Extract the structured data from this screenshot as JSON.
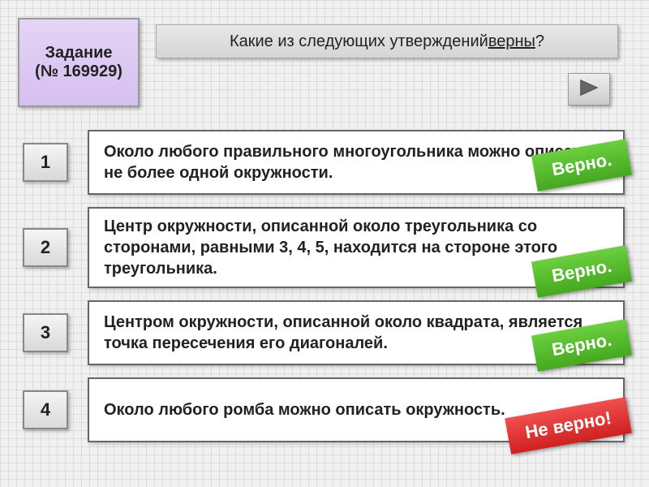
{
  "task": {
    "label": "Задание",
    "number": "(№ 169929)"
  },
  "question": {
    "prefix": "Какие из следующих утверждений ",
    "underlined": "верны",
    "suffix": "?"
  },
  "answers": [
    {
      "num": "1",
      "text": "Около любого правильного многоугольника можно описать не более одной окружности.",
      "badge": "Верно.",
      "correct": true
    },
    {
      "num": "2",
      "text": "Центр окружности, описанной около треугольника со сторонами, равными 3, 4, 5, находится на стороне этого треугольника.",
      "badge": "Верно.",
      "correct": true
    },
    {
      "num": "3",
      "text": "Центром окружности, описанной около квадрата, является точка пересечения его диагоналей.",
      "badge": "Верно.",
      "correct": true
    },
    {
      "num": "4",
      "text": "Около любого ромба можно описать окружность.",
      "badge": "Не верно!",
      "correct": false
    }
  ]
}
